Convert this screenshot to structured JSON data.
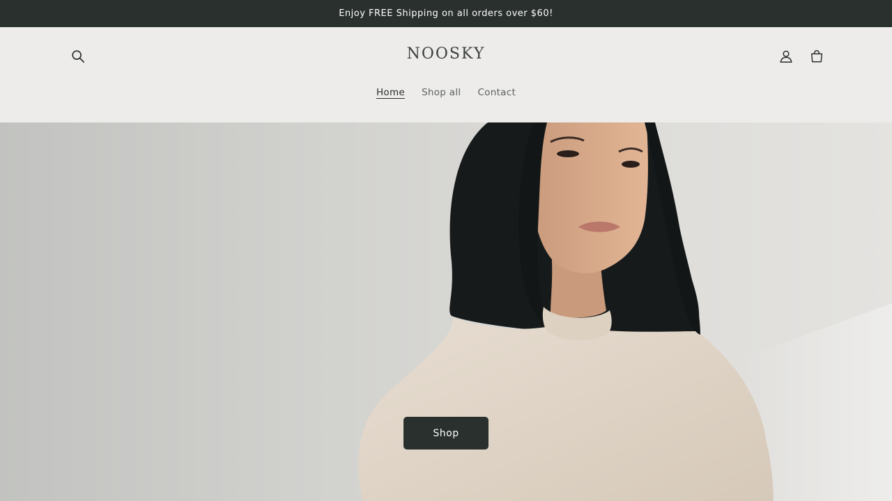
{
  "announcement": {
    "text": "Enjoy FREE Shipping on all orders over $60!"
  },
  "header": {
    "logo": "NOOSKY",
    "icons": {
      "search": "search-icon",
      "account": "user-icon",
      "cart": "cart-icon"
    },
    "nav": [
      {
        "label": "Home",
        "active": true
      },
      {
        "label": "Shop all",
        "active": false
      },
      {
        "label": "Contact",
        "active": false
      }
    ]
  },
  "hero": {
    "button_label": "Shop",
    "image": "woman-in-cream-sweater-photo"
  },
  "colors": {
    "announcement_bg": "#29302d",
    "header_bg": "#edecea",
    "button_bg": "#29302d",
    "text": "#2b2f2d"
  }
}
